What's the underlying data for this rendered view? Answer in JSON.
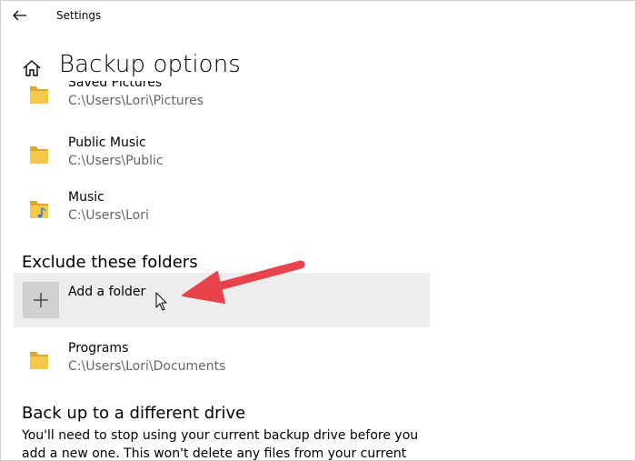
{
  "titlebar": {
    "app_title": "Settings"
  },
  "header": {
    "page_title": "Backup options"
  },
  "back_up_folders": [
    {
      "name": "Saved Pictures",
      "path": "C:\\Users\\Lori\\Pictures",
      "icon": "folder-icon"
    },
    {
      "name": "Public Music",
      "path": "C:\\Users\\Public",
      "icon": "folder-icon"
    },
    {
      "name": "Music",
      "path": "C:\\Users\\Lori",
      "icon": "music-folder-icon"
    }
  ],
  "exclude_section": {
    "heading": "Exclude these folders",
    "add_label": "Add a folder",
    "items": [
      {
        "name": "Programs",
        "path": "C:\\Users\\Lori\\Documents",
        "icon": "folder-icon"
      }
    ]
  },
  "different_drive": {
    "heading": "Back up to a different drive",
    "description": "You'll need to stop using your current backup drive before you add a new one. This won't delete any files from your current backup"
  },
  "colors": {
    "folder_yellow": "#f4c84a",
    "folder_dark": "#dca82e",
    "row_hover": "#ededed",
    "add_tile": "#d0d0d0",
    "annotation_red": "#e8434c",
    "music_note": "#2a7dd1",
    "path_gray": "#666666"
  }
}
